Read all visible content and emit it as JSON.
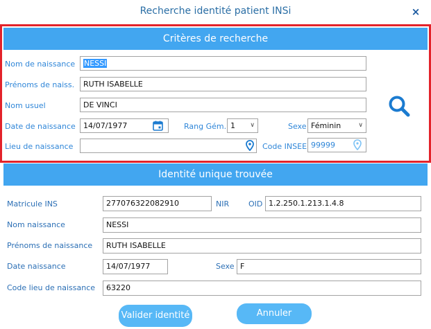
{
  "dialog": {
    "title": "Recherche identité patient INSi",
    "close_glyph": "×"
  },
  "search": {
    "banner": "Critères de recherche",
    "labels": {
      "nom_naissance": "Nom de naissance",
      "prenoms": "Prénoms de naiss.",
      "nom_usuel": "Nom usuel",
      "date_naissance": "Date de naissance",
      "rang": "Rang Gém.",
      "sexe": "Sexe",
      "lieu": "Lieu de naissance",
      "code_insee": "Code INSEE"
    },
    "values": {
      "nom_naissance": "NESSI",
      "prenoms": "RUTH ISABELLE",
      "nom_usuel": "DE VINCI",
      "date_naissance": "14/07/1977",
      "rang": "1",
      "sexe": "Féminin",
      "lieu": "",
      "code_insee": "99999"
    }
  },
  "result": {
    "banner": "Identité unique trouvée",
    "labels": {
      "matricule": "Matricule INS",
      "nir": "NIR",
      "oid": "OID",
      "nom": "Nom naissance",
      "prenoms": "Prénoms de naissance",
      "date": "Date naissance",
      "sexe": "Sexe",
      "code_lieu": "Code lieu de naissance"
    },
    "values": {
      "matricule": "277076322082910",
      "oid": "1.2.250.1.213.1.4.8",
      "nom": "NESSI",
      "prenoms": "RUTH ISABELLE",
      "date": "14/07/1977",
      "sexe": "F",
      "code_lieu": "63220"
    }
  },
  "buttons": {
    "valider": "Valider identité",
    "annuler": "Annuler"
  },
  "colors": {
    "accent": "#42a6f0",
    "label": "#2f86d8",
    "frame": "#e3222a",
    "icon": "#1b7bd0"
  }
}
